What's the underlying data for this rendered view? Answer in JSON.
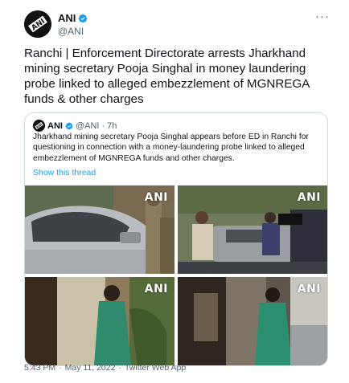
{
  "tweet": {
    "author_name": "ANI",
    "author_handle": "@ANI",
    "avatar_logo_text": "ANI",
    "more_icon": "more-dots-icon",
    "text": "Ranchi | Enforcement Directorate arrests Jharkhand mining secretary Pooja Singhal in money laundering probe linked to alleged embezzlement of MGNREGA funds & other charges",
    "footer": {
      "time": "5:43 PM",
      "separator": "·",
      "date": "May 11, 2022",
      "separator2": "·",
      "source": "Twitter Web App"
    }
  },
  "quote": {
    "author_name": "ANI",
    "author_handle": "@ANI",
    "separator": "·",
    "time": "7h",
    "text": "Jharkhand mining secretary Pooja Singhal appears before ED in Ranchi for questioning in connection with a money-laundering probe linked to alleged embezzlement of MGNREGA funds and other charges.",
    "show_thread": "Show this thread",
    "media_watermarks": [
      "ANI",
      "ANI",
      "ANI",
      "ANI"
    ]
  },
  "colors": {
    "accent": "#1d9bf0",
    "secondary_text": "#536471",
    "border": "#cfd9de"
  }
}
